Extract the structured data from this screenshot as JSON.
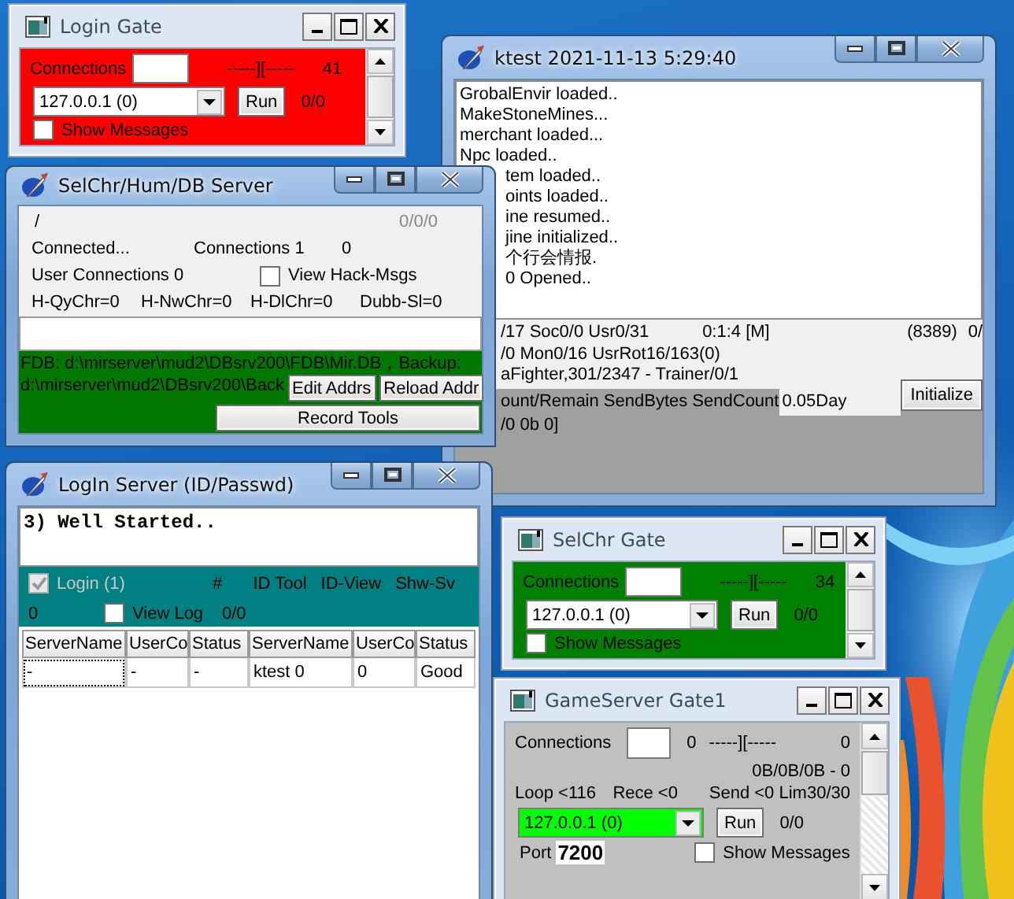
{
  "ktest_window": {
    "title": "ktest 2021-11-13 5:29:40",
    "log_lines": [
      "GrobalEnvir loaded..",
      "MakeStoneMines...",
      "merchant loaded...",
      "Npc loaded.."
    ],
    "log_lines_partly_hidden": [
      "tem loaded..",
      "oints loaded..",
      "ine resumed..",
      "jine initialized..",
      "个行会情报.",
      "0 Opened.."
    ],
    "status_counts": "/17 Soc0/0 Usr0/31",
    "uptime": "0:1:4 [M]",
    "status_code": "(8389)",
    "status_column_4": "0/",
    "monsters_line": "/0 Mon0/16 UsrRot16/163(0)",
    "fighter_line": "aFighter,301/2347 - Trainer/0/1",
    "send_header": "ount/Remain SendBytes SendCount",
    "day_value": "0.05Day",
    "initialize_button": "Initialize",
    "send_values": "/0 0b 0]"
  },
  "gates": [
    {
      "title": "Login Gate",
      "color": "#ff0000",
      "connections_label": "Connections",
      "meter": "-----][-----",
      "count": "41",
      "address": "127.0.0.1 (0)",
      "run_button": "Run",
      "ratio": "0/0",
      "show_messages": {
        "label": "Show Messages",
        "checked": false
      }
    },
    {
      "title": "SelChr Gate",
      "color": "#008000",
      "connections_label": "Connections",
      "meter": "-----][-----",
      "count": "34",
      "address": "127.0.0.1 (0)",
      "run_button": "Run",
      "ratio": "0/0",
      "show_messages": {
        "label": "Show Messages",
        "checked": false
      }
    }
  ],
  "db_server": {
    "title": "SelChr/Hum/DB Server",
    "path": "/",
    "counter": "0/0/0",
    "status": "Connected...",
    "connections": "Connections 1",
    "connections_value": "0",
    "user_connections": "User Connections 0",
    "view_hack_msgs": {
      "label": "View Hack-Msgs",
      "checked": false
    },
    "hack_counters": [
      "H-QyChr=0",
      "H-NwChr=0",
      "H-DlChr=0",
      "Dubb-Sl=0"
    ],
    "db_paths": [
      "FDB: d:\\mirserver\\mud2\\DBsrv200\\FDB\\Mir.DB，Backup:",
      "d:\\mirserver\\mud2\\DBsrv200\\Back"
    ],
    "buttons": [
      "Edit Addrs",
      "Reload Addr",
      "Record Tools"
    ]
  },
  "login_server": {
    "title": "LogIn Server (ID/Passwd)",
    "log_text": "3) Well Started..",
    "login_checkbox": {
      "label": "Login (1)",
      "checked": true,
      "disabled": true
    },
    "hash_label": "#",
    "id_tool": "ID Tool",
    "id_view": "ID-View",
    "shw_sv": "Shw-Sv",
    "count": "0",
    "view_log": {
      "label": "View Log",
      "checked": false
    },
    "log_count": "0/0",
    "table": {
      "columns": [
        "ServerName",
        "UserCo",
        "Status",
        "ServerName",
        "UserCo",
        "Status"
      ],
      "rows": [
        [
          "-",
          "-",
          "-",
          "ktest 0",
          "0",
          "Good"
        ]
      ]
    }
  },
  "game_gate": {
    "title": "GameServer Gate1",
    "connections_label": "Connections",
    "connections_value": "0",
    "meter": "-----][-----",
    "count": "0",
    "traffic": "0B/0B/0B - 0",
    "loop": "Loop <116",
    "rece": "Rece <0",
    "send": "Send <0 Lim30/30",
    "address": "127.0.0.1 (0)",
    "run_button": "Run",
    "ratio": "0/0",
    "port_label": "Port",
    "port": "7200",
    "show_messages": {
      "label": "Show Messages",
      "checked": false
    }
  }
}
